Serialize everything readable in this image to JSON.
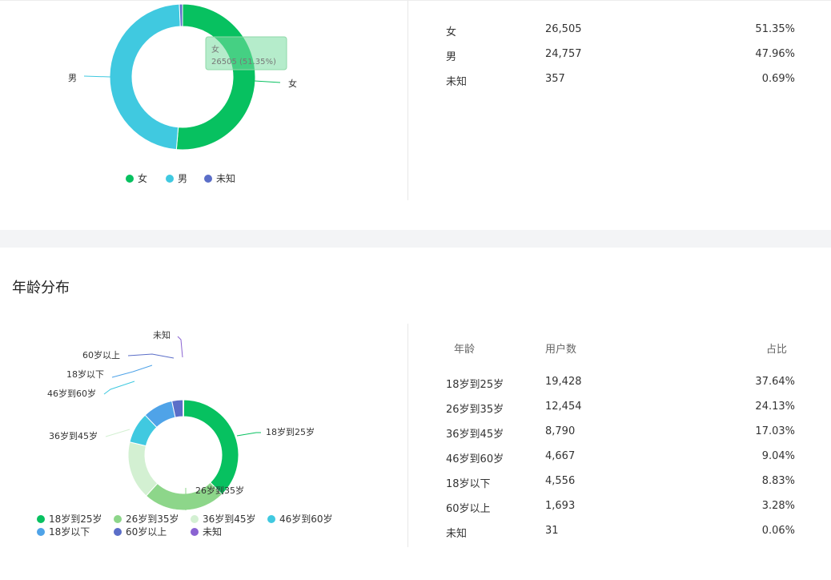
{
  "gender": {
    "chart_data": {
      "type": "pie",
      "categories": [
        "女",
        "男",
        "未知"
      ],
      "values": [
        26505,
        24757,
        357
      ],
      "colors": [
        "#07c160",
        "#40c9e0",
        "#5b6ec8"
      ],
      "legend_position": "bottom-center"
    },
    "tooltip": {
      "name": "女",
      "value": "26505 (51.35%)"
    },
    "table": {
      "rows": [
        {
          "label": "女",
          "count": "26,505",
          "pct": "51.35%"
        },
        {
          "label": "男",
          "count": "24,757",
          "pct": "47.96%"
        },
        {
          "label": "未知",
          "count": "357",
          "pct": "0.69%"
        }
      ]
    }
  },
  "age": {
    "title": "年龄分布",
    "chart_data": {
      "type": "pie",
      "categories": [
        "18岁到25岁",
        "26岁到35岁",
        "36岁到45岁",
        "46岁到60岁",
        "18岁以下",
        "60岁以上",
        "未知"
      ],
      "values": [
        19428,
        12454,
        8790,
        4667,
        4556,
        1693,
        31
      ],
      "colors": [
        "#07c160",
        "#8dd68a",
        "#d3f0d2",
        "#40c9e0",
        "#4fa3e8",
        "#5b6ec8",
        "#8a63d2"
      ],
      "legend_position": "bottom-left"
    },
    "table": {
      "headers": {
        "age": "年龄",
        "users": "用户数",
        "share": "占比"
      },
      "rows": [
        {
          "label": "18岁到25岁",
          "count": "19,428",
          "pct": "37.64%"
        },
        {
          "label": "26岁到35岁",
          "count": "12,454",
          "pct": "24.13%"
        },
        {
          "label": "36岁到45岁",
          "count": "8,790",
          "pct": "17.03%"
        },
        {
          "label": "46岁到60岁",
          "count": "4,667",
          "pct": "9.04%"
        },
        {
          "label": "18岁以下",
          "count": "4,556",
          "pct": "8.83%"
        },
        {
          "label": "60岁以上",
          "count": "1,693",
          "pct": "3.28%"
        },
        {
          "label": "未知",
          "count": "31",
          "pct": "0.06%"
        }
      ]
    }
  }
}
